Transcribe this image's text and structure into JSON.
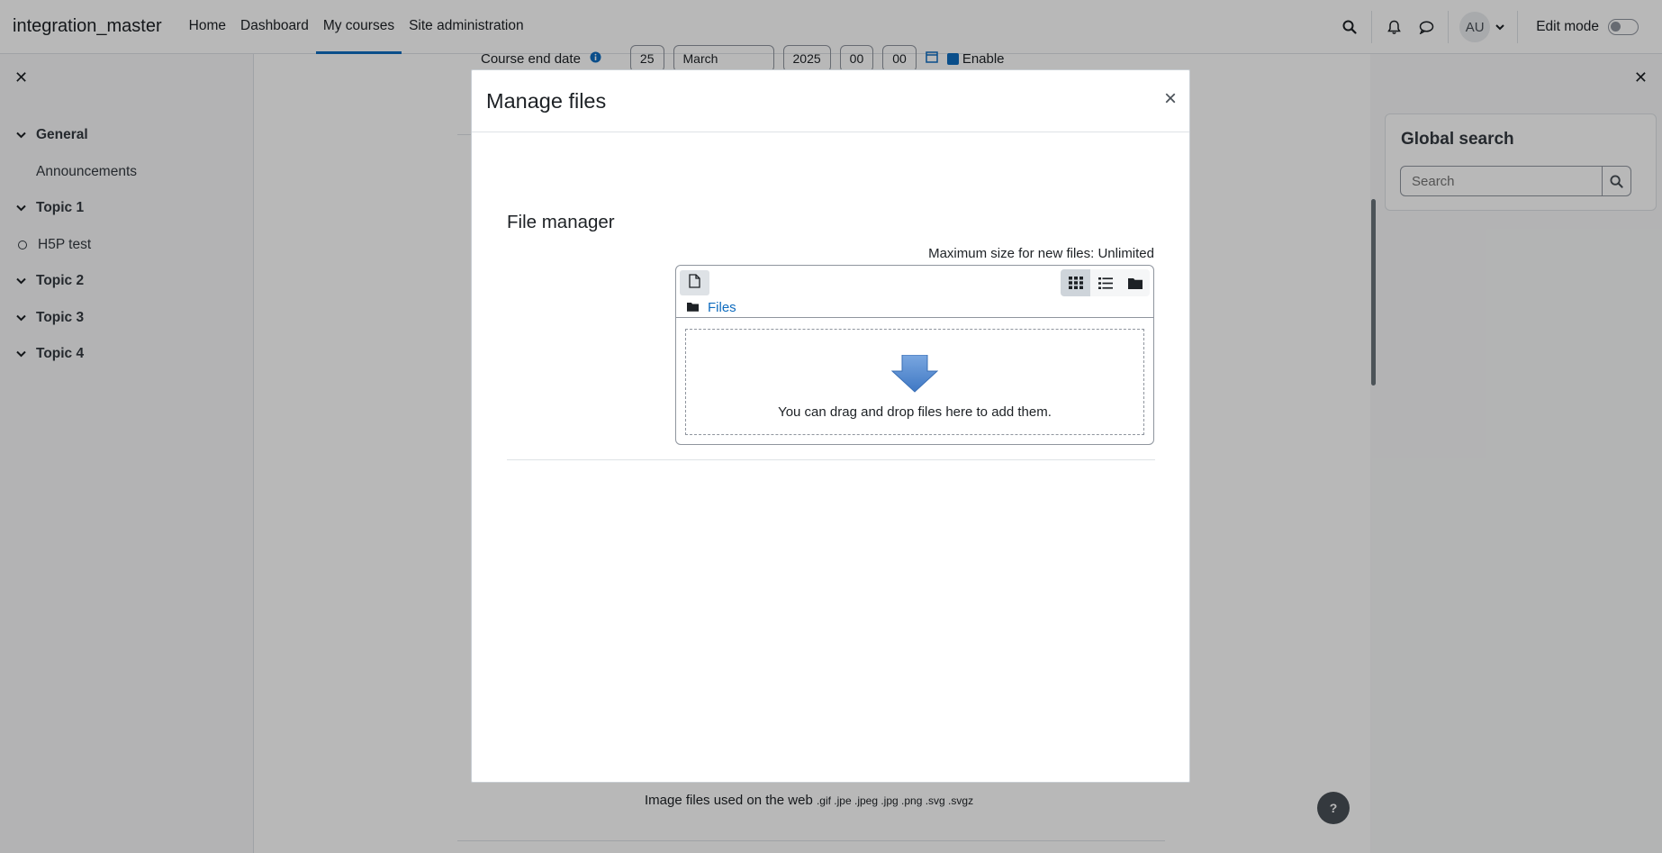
{
  "navbar": {
    "brand": "integration_master",
    "links": [
      "Home",
      "Dashboard",
      "My courses",
      "Site administration"
    ],
    "active_link": "My courses",
    "avatar_initials": "AU",
    "edit_mode_label": "Edit mode",
    "edit_mode_on": false
  },
  "course_index": {
    "sections": [
      {
        "title": "General",
        "activities": [
          "Announcements"
        ]
      },
      {
        "title": "Topic 1",
        "activities": [
          "H5P test"
        ]
      },
      {
        "title": "Topic 2",
        "activities": []
      },
      {
        "title": "Topic 3",
        "activities": []
      },
      {
        "title": "Topic 4",
        "activities": []
      }
    ]
  },
  "background_form": {
    "field_label": "Course end date",
    "day": "25",
    "month": "March",
    "year": "2025",
    "hour": "00",
    "minute": "00",
    "enable_label": "Enable",
    "accepted_types_label": "Image files used on the web",
    "accepted_types_ext": ".gif .jpe .jpeg .jpg .png .svg .svgz"
  },
  "right_drawer": {
    "block_title": "Global search",
    "search_placeholder": "Search"
  },
  "modal": {
    "title": "Manage files",
    "file_manager_title": "File manager",
    "max_size": "Maximum size for new files: Unlimited",
    "path_root": "Files",
    "dropzone_text": "You can drag and drop files here to add them."
  },
  "help_button": "?",
  "colors": {
    "accent": "#0f6cbf",
    "dropzone_arrow": "#4a86d0"
  }
}
